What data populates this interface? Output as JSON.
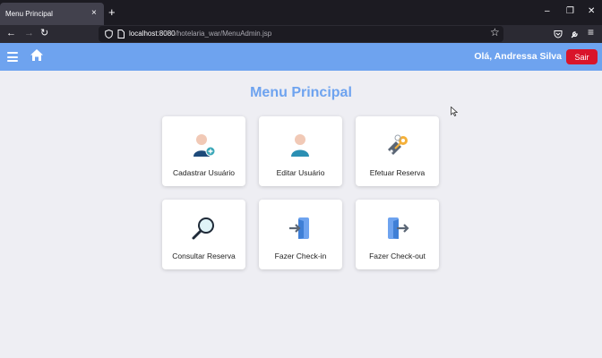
{
  "browser": {
    "tab_title": "Menu Principal",
    "tab_close": "×",
    "new_tab": "+",
    "url_host": "localhost:8080",
    "url_path": "/hotelaria_war/MenuAdmin.jsp",
    "window_controls": {
      "minimize": "–",
      "restore": "❐",
      "close": "✕"
    },
    "nav": {
      "back": "←",
      "forward": "→",
      "reload": "↻",
      "bookmark": "☆"
    }
  },
  "header": {
    "greeting": "Olá, Andressa Silva",
    "logout_label": "Sair",
    "color": "#6ea3ef",
    "logout_color": "#d9142a"
  },
  "main": {
    "title": "Menu Principal",
    "cards": [
      {
        "label": "Cadastrar Usuário",
        "icon": "add-user-icon"
      },
      {
        "label": "Editar Usuário",
        "icon": "user-icon"
      },
      {
        "label": "Efetuar Reserva",
        "icon": "key-tag-icon"
      },
      {
        "label": "Consultar Reserva",
        "icon": "magnifier-icon"
      },
      {
        "label": "Fazer Check-in",
        "icon": "door-enter-icon"
      },
      {
        "label": "Fazer Check-out",
        "icon": "door-exit-icon"
      }
    ]
  }
}
